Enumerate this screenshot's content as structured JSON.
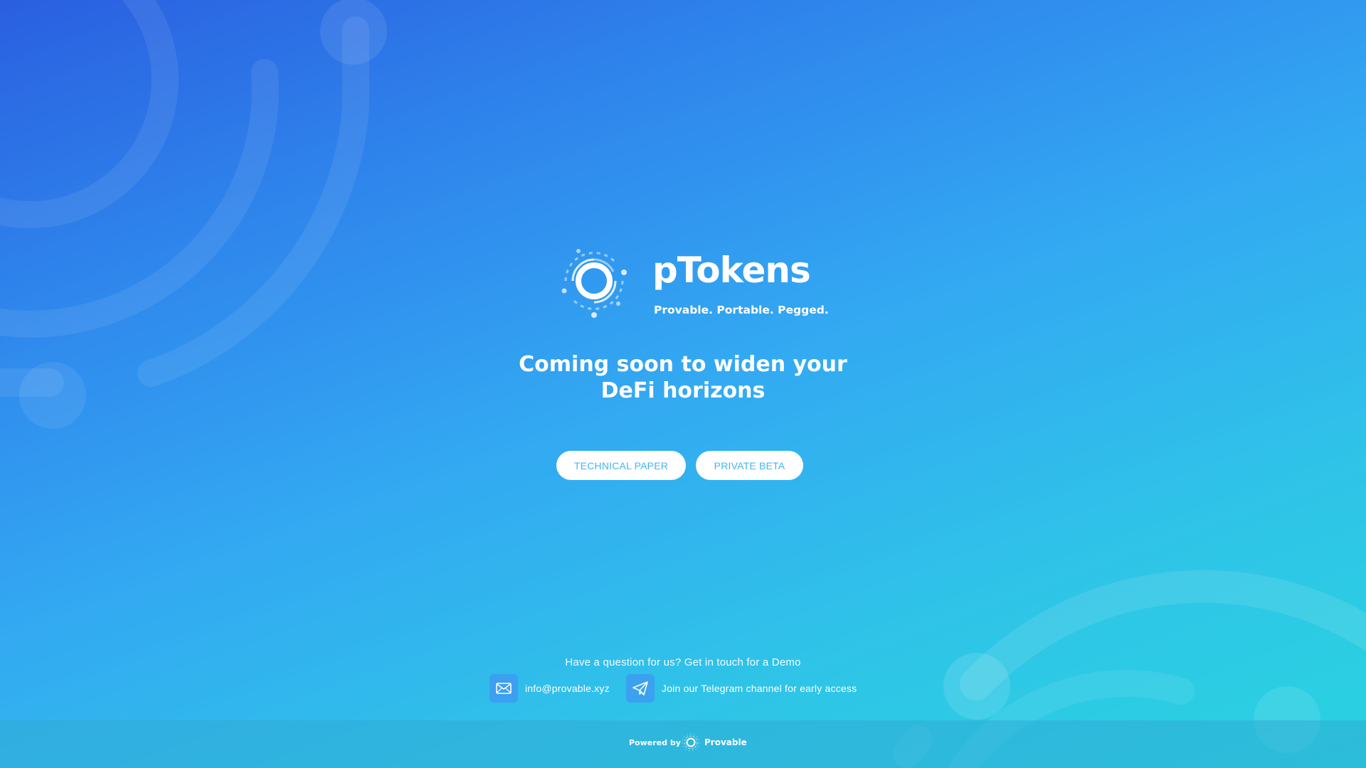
{
  "brand": {
    "name": "pTokens",
    "tagline": "Provable. Portable. Pegged."
  },
  "hero": {
    "headline_line1": "Coming soon to widen your",
    "headline_line2": "DeFi horizons"
  },
  "buttons": {
    "technical_paper": "TECHNICAL PAPER",
    "private_beta": "PRIVATE BETA"
  },
  "contact": {
    "question": "Have a question for us? Get in touch for a Demo",
    "email": "info@provable.xyz",
    "telegram": "Join our Telegram channel for early access"
  },
  "footer": {
    "powered_by": "Powered by",
    "provider": "Provable"
  },
  "icons": {
    "brand_logo": "ptokens-logo-icon",
    "email": "mail-icon",
    "telegram": "paper-plane-icon",
    "provider_logo": "provable-logo-icon"
  },
  "colors": {
    "gradient_top_left": "#2a5fe0",
    "gradient_middle": "#33a9f2",
    "gradient_bottom_right": "#29d3e0",
    "button_text": "#46b4ef",
    "button_bg": "#ffffff",
    "contact_icon_bg": "#4096f2"
  }
}
